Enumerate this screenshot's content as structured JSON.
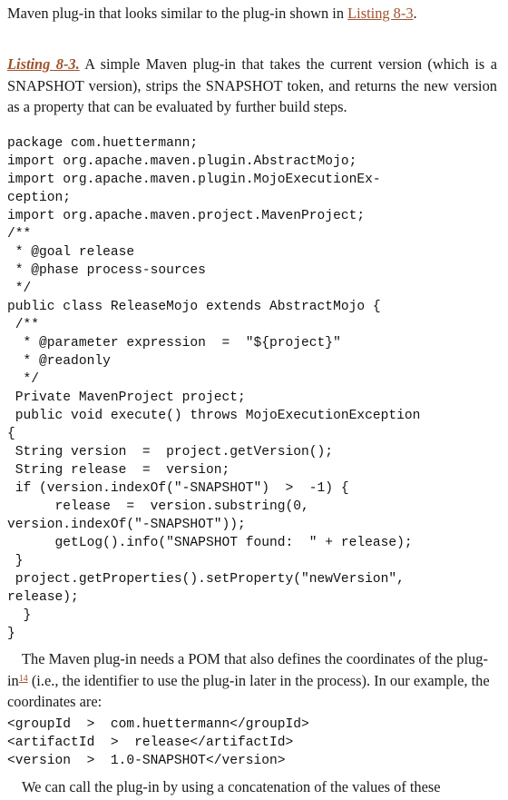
{
  "intro": {
    "text": "Maven plug-in that looks similar to the plug-in shown in ",
    "link": "Listing 8-3",
    "end": "."
  },
  "listing": {
    "label": "Listing 8-3.",
    "caption": " A simple Maven plug-in that takes the current version (which is a SNAPSHOT version), strips the SNAPSHOT token, and returns the new version as a property that can be evaluated by further build steps."
  },
  "code_lines": [
    "package com.huettermann;",
    "import org.apache.maven.plugin.AbstractMojo;",
    "import org.apache.maven.plugin.MojoExecutionEx-",
    "ception;",
    "import org.apache.maven.project.MavenProject;",
    "/**",
    " * @goal release",
    " * @phase process-sources",
    " */",
    "public class ReleaseMojo extends AbstractMojo {",
    " /**",
    "  * @parameter expression  =  \"${project}\"",
    "  * @readonly",
    "  */",
    " Private MavenProject project;",
    " public void execute() throws MojoExecutionException",
    "{",
    " String version  =  project.getVersion();",
    " String release  =  version;",
    " if (version.indexOf(\"-SNAPSHOT\")  >  -1) {",
    "      release  =  version.substring(0,",
    "version.indexOf(\"-SNAPSHOT\"));",
    "      getLog().info(\"SNAPSHOT found:  \" + release);",
    " }",
    " project.getProperties().setProperty(\"newVersion\",",
    "release);",
    "  }",
    "}"
  ],
  "paragraph": {
    "before": "The Maven plug-in needs a POM that also defines the coordinates of the plug-in",
    "footnote": "14",
    "after": " (i.e., the identifier to use the plug-in later in the process). In our example, the coordinates are:"
  },
  "coord_lines": [
    "<groupId  >  com.huettermann</groupId>",
    "<artifactId  >  release</artifactId>",
    "<version  >  1.0-SNAPSHOT</version>"
  ],
  "closing": "We can call the plug-in by using a concatenation of the values of these"
}
